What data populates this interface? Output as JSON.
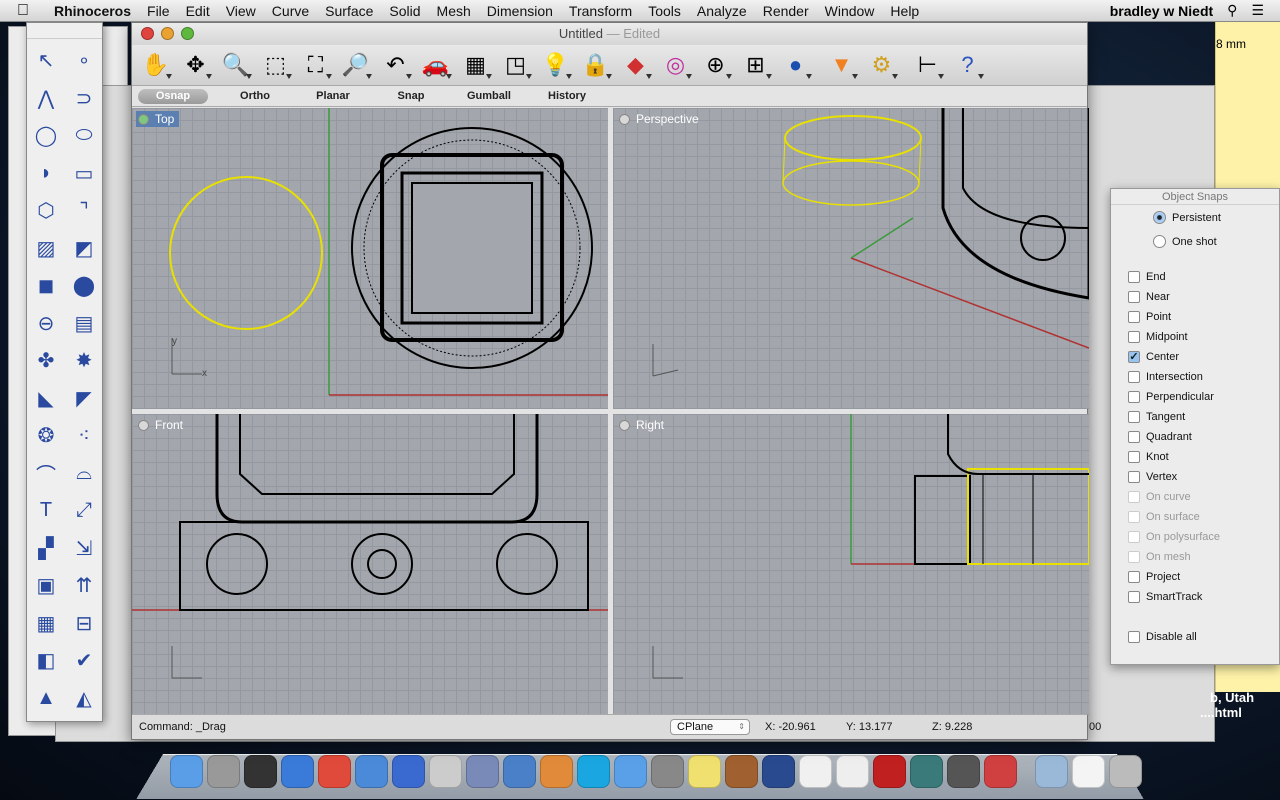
{
  "menubar": {
    "app": "Rhinoceros",
    "items": [
      "File",
      "Edit",
      "View",
      "Curve",
      "Surface",
      "Solid",
      "Mesh",
      "Dimension",
      "Transform",
      "Tools",
      "Analyze",
      "Render",
      "Window",
      "Help"
    ],
    "user": "bradley w Niedt"
  },
  "window": {
    "title": "Untitled",
    "edited": "— Edited"
  },
  "toolbar": {
    "icons": [
      "pan-icon",
      "rotate-view-icon",
      "zoom-in-icon",
      "zoom-window-icon",
      "zoom-extents-icon",
      "zoom-selected-icon",
      "undo-view-icon",
      "car-icon",
      "grid-plane-icon",
      "gumball-icon",
      "light-bulb-icon",
      "lock-icon",
      "layer-icon",
      "color-wheel-icon",
      "wireframe-sphere-icon",
      "grid-sphere-icon",
      "render-sphere-icon",
      "cone-icon",
      "gear-icon",
      "dimension-icon",
      "help-icon"
    ]
  },
  "tabs": [
    {
      "label": "Osnap",
      "active": true
    },
    {
      "label": "Ortho"
    },
    {
      "label": "Planar"
    },
    {
      "label": "Snap"
    },
    {
      "label": "Gumball"
    },
    {
      "label": "History"
    }
  ],
  "viewports": {
    "top": "Top",
    "perspective": "Perspective",
    "front": "Front",
    "right": "Right"
  },
  "status": {
    "command": "Command: _Drag",
    "cplane": "CPlane",
    "x": "X: -20.961",
    "y": "Y: 13.177",
    "z": "Z: 9.228",
    "extra": "00"
  },
  "osnap": {
    "title": "Object Snaps",
    "mode": [
      {
        "label": "Persistent",
        "on": true
      },
      {
        "label": "One shot",
        "on": false
      }
    ],
    "items": [
      {
        "label": "End"
      },
      {
        "label": "Near"
      },
      {
        "label": "Point"
      },
      {
        "label": "Midpoint"
      },
      {
        "label": "Center",
        "checked": true
      },
      {
        "label": "Intersection"
      },
      {
        "label": "Perpendicular"
      },
      {
        "label": "Tangent"
      },
      {
        "label": "Quadrant"
      },
      {
        "label": "Knot"
      },
      {
        "label": "Vertex"
      },
      {
        "label": "On curve",
        "disabled": true
      },
      {
        "label": "On surface",
        "disabled": true
      },
      {
        "label": "On polysurface",
        "disabled": true
      },
      {
        "label": "On mesh",
        "disabled": true
      },
      {
        "label": "Project"
      },
      {
        "label": "SmartTrack"
      }
    ],
    "disable_all": "Disable all"
  },
  "note": {
    "text": "8 mm"
  },
  "desktop": {
    "line1": "b, Utah",
    "line2": "....html"
  },
  "colors": {
    "selection": "#e8e000",
    "x_axis": "#b03030",
    "y_axis": "#30a030"
  }
}
